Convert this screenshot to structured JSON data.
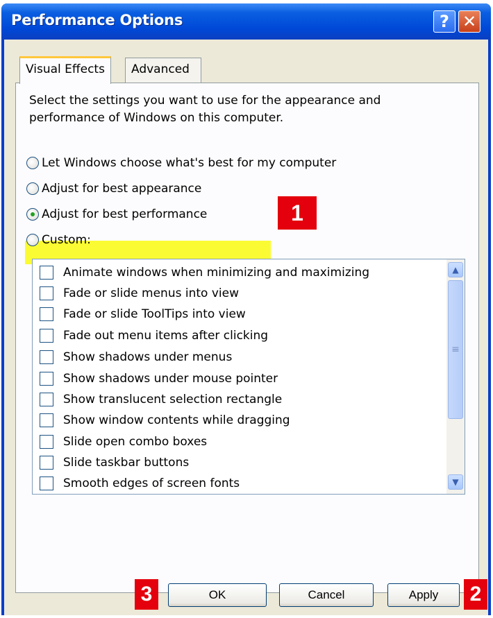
{
  "window": {
    "title": "Performance Options",
    "help": "?",
    "close": "✕"
  },
  "tabs": [
    "Visual Effects",
    "Advanced"
  ],
  "description": "Select the settings you want to use for the appearance and performance of Windows on this computer.",
  "radios": [
    {
      "label": "Let Windows choose what's best for my computer",
      "checked": false
    },
    {
      "label": "Adjust for best appearance",
      "checked": false
    },
    {
      "label": "Adjust for best performance",
      "checked": true
    },
    {
      "label": "Custom:",
      "checked": false
    }
  ],
  "effects": [
    "Animate windows when minimizing and maximizing",
    "Fade or slide menus into view",
    "Fade or slide ToolTips into view",
    "Fade out menu items after clicking",
    "Show shadows under menus",
    "Show shadows under mouse pointer",
    "Show translucent selection rectangle",
    "Show window contents while dragging",
    "Slide open combo boxes",
    "Slide taskbar buttons",
    "Smooth edges of screen fonts"
  ],
  "buttons": {
    "ok": "OK",
    "cancel": "Cancel",
    "apply": "Apply"
  },
  "badges": {
    "one": "1",
    "two": "2",
    "three": "3"
  },
  "colors": {
    "highlight": "#fbfb33",
    "badge": "#e4000c",
    "titlebar": "#0048d8"
  }
}
